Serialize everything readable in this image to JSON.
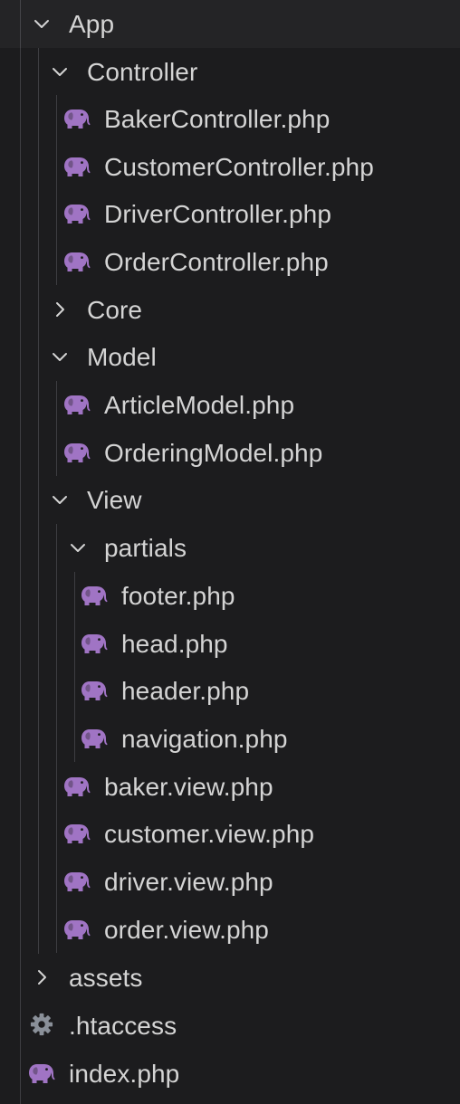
{
  "colors": {
    "background": "#1c1c1e",
    "text": "#d4d4d4",
    "php_icon": "#a074c4",
    "settings_icon": "#8a9099",
    "guide_line": "#3e3e42"
  },
  "tree": {
    "app": {
      "label": "App",
      "expanded": true
    },
    "controller": {
      "label": "Controller",
      "expanded": true
    },
    "controller_files": [
      "BakerController.php",
      "CustomerController.php",
      "DriverController.php",
      "OrderController.php"
    ],
    "core": {
      "label": "Core",
      "expanded": false
    },
    "model": {
      "label": "Model",
      "expanded": true
    },
    "model_files": [
      "ArticleModel.php",
      "OrderingModel.php"
    ],
    "view": {
      "label": "View",
      "expanded": true
    },
    "partials": {
      "label": "partials",
      "expanded": true
    },
    "partials_files": [
      "footer.php",
      "head.php",
      "header.php",
      "navigation.php"
    ],
    "view_files": [
      "baker.view.php",
      "customer.view.php",
      "driver.view.php",
      "order.view.php"
    ],
    "assets": {
      "label": "assets",
      "expanded": false
    },
    "htaccess": {
      "label": ".htaccess",
      "icon": "gear-icon"
    },
    "index": {
      "label": "index.php",
      "icon": "php-elephant-icon"
    }
  }
}
